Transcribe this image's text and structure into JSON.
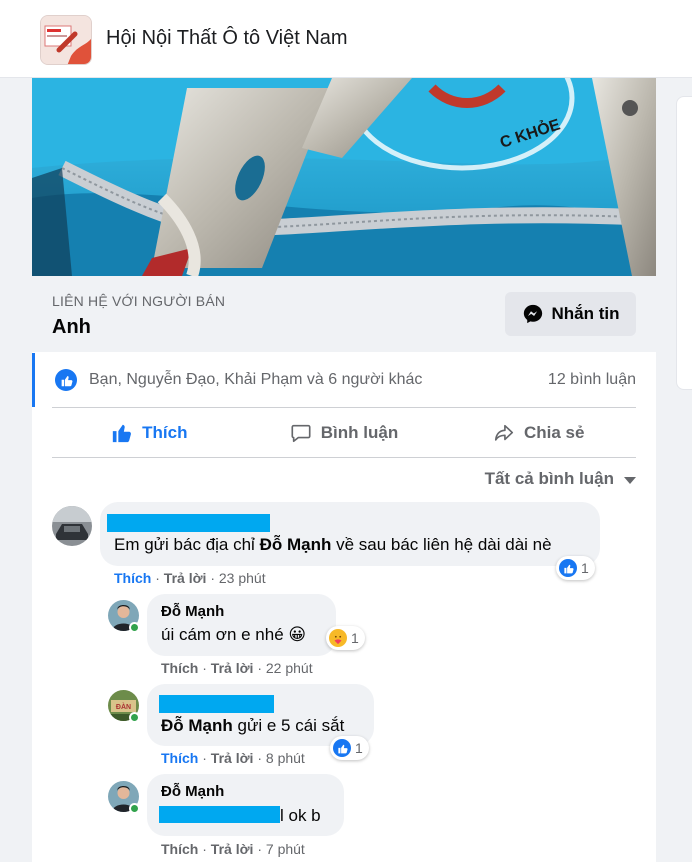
{
  "header": {
    "group_name": "Hội Nội Thất Ô tô Việt Nam",
    "group_icon": "group-cover-thumbnail"
  },
  "listing": {
    "photo_icon": "product-photo",
    "seller_caption": "LIÊN HỆ VỚI NGƯỜI BÁN",
    "seller_name": "Anh",
    "message_button": "Nhắn tin"
  },
  "reactions": {
    "names": "Bạn, Nguyễn Đạo, Khải Phạm và 6 người khác",
    "comment_count": "12 bình luận"
  },
  "actions": {
    "like": "Thích",
    "comment": "Bình luận",
    "share": "Chia sẻ"
  },
  "comments_filter": "Tất cả bình luận",
  "comments": [
    {
      "author": "",
      "text": "Em gửi bác địa chỉ ",
      "text_bold": "Đỗ Mạnh",
      "text_after": " về sau bác liên hệ dài dài nè",
      "like": "Thích",
      "reply": "Trả lời",
      "time": "23 phút",
      "reaction_count": "1",
      "reaction_type": "like",
      "liked": true
    },
    {
      "author": "Đỗ Mạnh",
      "text": "úi cám ơn e nhé",
      "emoji": "😀",
      "like": "Thích",
      "reply": "Trả lời",
      "time": "22 phút",
      "reaction_count": "1",
      "reaction_type": "care",
      "liked": false
    },
    {
      "author": "",
      "text_bold": "Đỗ Mạnh",
      "text_after": " gửi e 5 cái sắt",
      "like": "Thích",
      "reply": "Trả lời",
      "time": "8 phút",
      "reaction_count": "1",
      "reaction_type": "like",
      "liked": true
    },
    {
      "author": "Đỗ Mạnh",
      "text_after": "l ok b",
      "like": "Thích",
      "reply": "Trả lời",
      "time": "7 phút",
      "liked": false
    }
  ],
  "colors": {
    "accent": "#1877f2",
    "redaction": "#00a8f0",
    "online": "#31a24c"
  }
}
